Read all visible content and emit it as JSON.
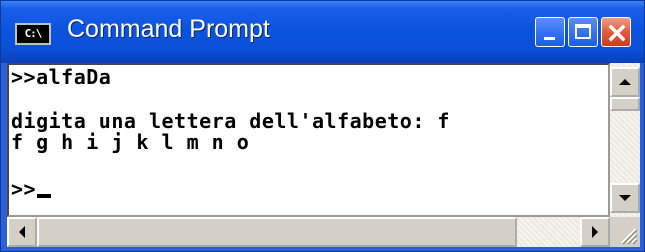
{
  "window": {
    "title": "Command Prompt",
    "icon_text": "C:\\",
    "accent": "#0b54e0",
    "close_color": "#e25a3a"
  },
  "console": {
    "lines": [
      ">>alfaDa",
      "digita una lettera dell'alfabeto: f",
      "f g h i j k l m n o",
      ">>"
    ]
  },
  "icons": {
    "minimize": "minimize-icon",
    "maximize": "maximize-icon",
    "close": "close-icon",
    "scroll_up": "arrow-up-icon",
    "scroll_down": "arrow-down-icon",
    "scroll_left": "arrow-left-icon",
    "scroll_right": "arrow-right-icon",
    "resize_grip": "resize-grip-icon"
  }
}
